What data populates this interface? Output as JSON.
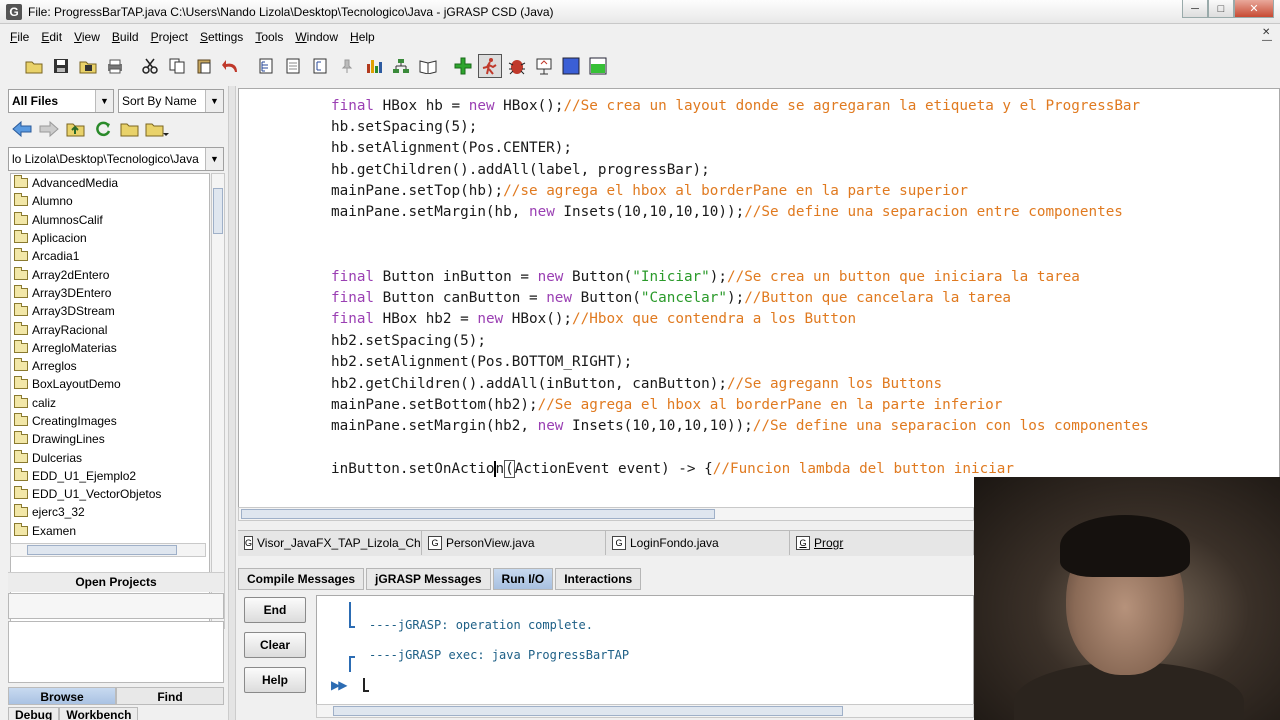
{
  "window": {
    "title": "File: ProgressBarTAP.java  C:\\Users\\Nando Lizola\\Desktop\\Tecnologico\\Java - jGRASP CSD (Java)",
    "app_icon": "G",
    "minimize": "─",
    "maximize": "□",
    "close": "✕"
  },
  "menu": {
    "items": [
      "File",
      "Edit",
      "View",
      "Build",
      "Project",
      "Settings",
      "Tools",
      "Window",
      "Help"
    ],
    "right_glyph": "✕\n─"
  },
  "toolbar": {
    "icons": [
      "open-folder-icon",
      "save-icon",
      "save-all-icon",
      "print-icon",
      "cut-icon",
      "copy-icon",
      "paste-icon",
      "undo-icon",
      "csd-generate-icon",
      "csd-remove-icon",
      "fold-icon",
      "pin-icon",
      "bar-chart-icon",
      "uml-icon",
      "book-icon",
      "compile-icon",
      "run-icon",
      "debug-bug-icon",
      "applet-icon",
      "blue-square-icon",
      "green-square-icon"
    ]
  },
  "browse": {
    "filter": "All Files",
    "sort": "Sort By Name",
    "path": "lo Lizola\\Desktop\\Tecnologico\\Java",
    "folders": [
      "AdvancedMedia",
      "Alumno",
      "AlumnosCalif",
      "Aplicacion",
      "Arcadia1",
      "Array2dEntero",
      "Array3DEntero",
      "Array3DStream",
      "ArrayRacional",
      "ArregloMaterias",
      "Arreglos",
      "BoxLayoutDemo",
      "caliz",
      "CreatingImages",
      "DrawingLines",
      "Dulcerias",
      "EDD_U1_Ejemplo2",
      "EDD_U1_VectorObjetos",
      "ejerc3_32",
      "Examen"
    ],
    "open_projects_label": "Open Projects",
    "tab_browse": "Browse",
    "tab_find": "Find",
    "tab_debug": "Debug",
    "tab_workbench": "Workbench"
  },
  "editor": {
    "lines": [
      {
        "kw": "final",
        "code": " HBox hb = ",
        "kw2": "new",
        "code2": " HBox();",
        "str": "",
        "code3": "",
        "comment": "//Se crea un layout donde se agregaran la etiqueta y el ProgressBar"
      },
      {
        "kw": "",
        "code": "hb.setSpacing(5);",
        "kw2": "",
        "code2": "",
        "str": "",
        "code3": "",
        "comment": ""
      },
      {
        "kw": "",
        "code": "hb.setAlignment(Pos.CENTER);",
        "kw2": "",
        "code2": "",
        "str": "",
        "code3": "",
        "comment": ""
      },
      {
        "kw": "",
        "code": "hb.getChildren().addAll(label, progressBar);",
        "kw2": "",
        "code2": "",
        "str": "",
        "code3": "",
        "comment": ""
      },
      {
        "kw": "",
        "code": "mainPane.setTop(hb);",
        "kw2": "",
        "code2": "",
        "str": "",
        "code3": "",
        "comment": "//se agrega el hbox al borderPane en la parte superior"
      },
      {
        "kw": "",
        "code": "mainPane.setMargin(hb, ",
        "kw2": "new",
        "code2": " Insets(10,10,10,10));",
        "str": "",
        "code3": "",
        "comment": "//Se define una separacion entre componentes"
      },
      {
        "kw": "final",
        "code": " Button inButton = ",
        "kw2": "new",
        "code2": " Button(",
        "str": "\"Iniciar\"",
        "code3": ");",
        "comment": "//Se crea un button que iniciara la tarea"
      },
      {
        "kw": "final",
        "code": " Button canButton = ",
        "kw2": "new",
        "code2": " Button(",
        "str": "\"Cancelar\"",
        "code3": ");",
        "comment": "//Button que cancelara la tarea"
      },
      {
        "kw": "final",
        "code": " HBox hb2 = ",
        "kw2": "new",
        "code2": " HBox();",
        "str": "",
        "code3": "",
        "comment": "//Hbox que contendra a los Button"
      },
      {
        "kw": "",
        "code": "hb2.setSpacing(5);",
        "kw2": "",
        "code2": "",
        "str": "",
        "code3": "",
        "comment": ""
      },
      {
        "kw": "",
        "code": "hb2.setAlignment(Pos.BOTTOM_RIGHT);",
        "kw2": "",
        "code2": "",
        "str": "",
        "code3": "",
        "comment": ""
      },
      {
        "kw": "",
        "code": "hb2.getChildren().addAll(inButton, canButton);",
        "kw2": "",
        "code2": "",
        "str": "",
        "code3": "",
        "comment": "//Se agregann los Buttons"
      },
      {
        "kw": "",
        "code": "mainPane.setBottom(hb2);",
        "kw2": "",
        "code2": "",
        "str": "",
        "code3": "",
        "comment": "//Se agrega el hbox al borderPane en la parte inferior"
      },
      {
        "kw": "",
        "code": "mainPane.setMargin(hb2, ",
        "kw2": "new",
        "code2": " Insets(10,10,10,10));",
        "str": "",
        "code3": "",
        "comment": "//Se define una separacion con los componentes"
      }
    ],
    "last_line_before_caret": "inButton.setOnActio",
    "last_line_after_caret": "n",
    "last_line_bracket": "(",
    "last_line_rest": "ActionEvent event) -> {",
    "last_line_comment": "//Funcion lambda del button iniciar"
  },
  "file_tabs": [
    {
      "label": "Visor_JavaFX_TAP_Lizola_Chav...",
      "current": false
    },
    {
      "label": "PersonView.java",
      "current": false
    },
    {
      "label": "LoginFondo.java",
      "current": false
    },
    {
      "label": "Progr",
      "current": true
    }
  ],
  "message_tabs": [
    "Compile Messages",
    "jGRASP Messages",
    "Run I/O",
    "Interactions"
  ],
  "active_message_tab": "Run I/O",
  "io": {
    "buttons": [
      "End",
      "Clear",
      "Help"
    ],
    "line1": "----jGRASP: operation complete.",
    "line2": "----jGRASP exec: java ProgressBarTAP",
    "prompt": "▶▶"
  },
  "colors": {
    "keyword": "#9a3fb3",
    "comment": "#e07a20",
    "string": "#2a9a2a",
    "io_text": "#1d5f86",
    "active_tab": "#a8c0e0"
  }
}
